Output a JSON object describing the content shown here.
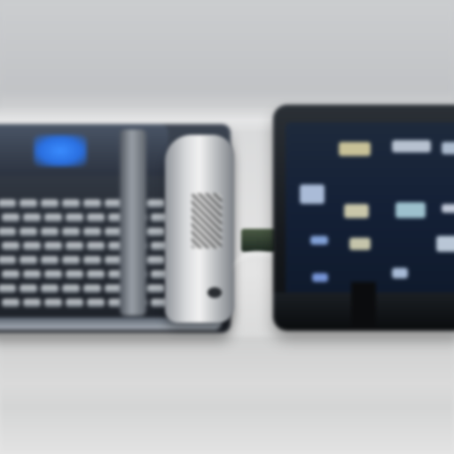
{
  "scene": {
    "description_type": "photograph",
    "subjects": [
      "left-phone",
      "hinge-slider",
      "right-phone"
    ],
    "colors": {
      "background": "#c9cbcd",
      "table": "#e4e4e4",
      "left_screen_glow": "#3a8cff",
      "right_screen": "#142036",
      "chrome": "#d7d9db"
    }
  }
}
